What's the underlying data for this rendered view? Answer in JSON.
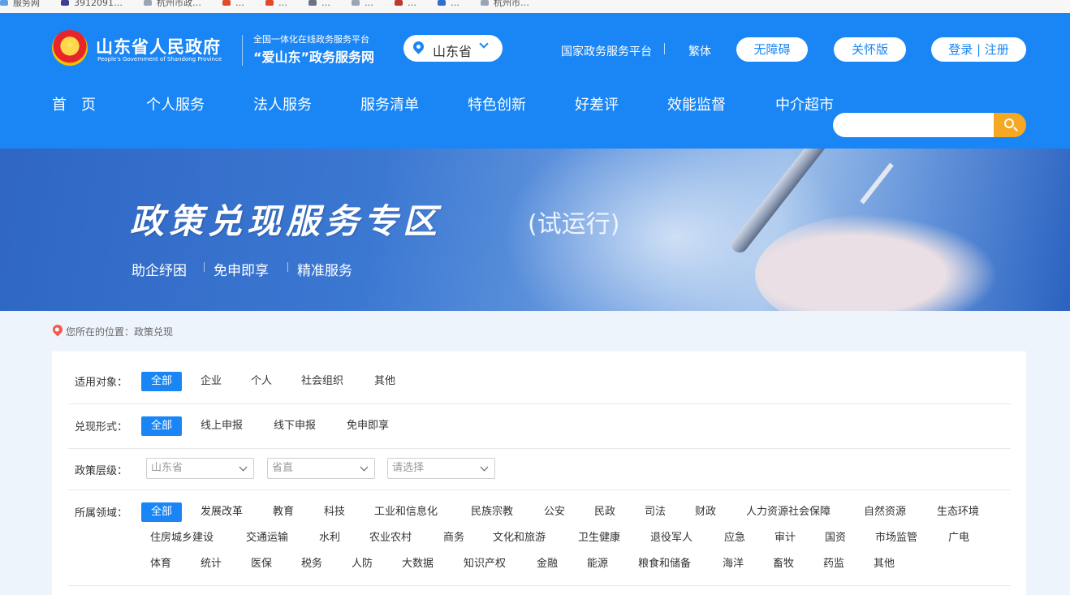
{
  "bookmarks": [
    {
      "label": "服务网",
      "color": "#5aa0e6"
    },
    {
      "label": "3912091…",
      "color": "#3a3f8f"
    },
    {
      "label": "杭州市政…",
      "color": "#9aa4b4"
    },
    {
      "label": "…",
      "color": "#e24a2a"
    },
    {
      "label": "…",
      "color": "#e24a2a"
    },
    {
      "label": "…",
      "color": "#6b7280"
    },
    {
      "label": "…",
      "color": "#9aa4b4"
    },
    {
      "label": "…",
      "color": "#c0392b"
    },
    {
      "label": "…",
      "color": "#2f6fd1"
    },
    {
      "label": "杭州市…",
      "color": "#9aa4b4"
    }
  ],
  "header": {
    "site_name": "山东省人民政府",
    "site_name_en": "People's Government of Shandong Province",
    "platform_line1": "全国一体化在线政务服务平台",
    "platform_line2": "“爱山东”政务服务网",
    "region": "山东省",
    "links": {
      "national_platform": "国家政务服务平台",
      "traditional": "繁体",
      "accessibility": "无障碍",
      "elder_mode": "关怀版",
      "login_register": "登录 | 注册"
    },
    "nav": [
      "首　页",
      "个人服务",
      "法人服务",
      "服务清单",
      "特色创新",
      "好差评",
      "效能监督",
      "中介超市"
    ],
    "search_placeholder": ""
  },
  "banner": {
    "title": "政策兑现服务专区",
    "subtitle": "(试运行)",
    "taglines": [
      "助企纾困",
      "免申即享",
      "精准服务"
    ]
  },
  "breadcrumb": "您所在的位置：政策兑现",
  "filters": {
    "target": {
      "label": "适用对象：",
      "options": [
        "全部",
        "企业",
        "个人",
        "社会组织",
        "其他"
      ]
    },
    "form": {
      "label": "兑现形式：",
      "options": [
        "全部",
        "线上申报",
        "线下申报",
        "免申即享"
      ]
    },
    "level": {
      "label": "政策层级：",
      "selects": [
        "山东省",
        "省直",
        "请选择"
      ]
    },
    "field": {
      "label": "所属领域：",
      "row1": [
        "全部",
        "发展改革",
        "教育",
        "科技",
        "工业和信息化",
        "民族宗教",
        "公安",
        "民政",
        "司法",
        "财政",
        "人力资源社会保障",
        "自然资源",
        "生态环境"
      ],
      "row2": [
        "住房城乡建设",
        "交通运输",
        "水利",
        "农业农村",
        "商务",
        "文化和旅游",
        "卫生健康",
        "退役军人",
        "应急",
        "审计",
        "国资",
        "市场监管",
        "广电"
      ],
      "row3": [
        "体育",
        "统计",
        "医保",
        "税务",
        "人防",
        "大数据",
        "知识产权",
        "金融",
        "能源",
        "粮食和储备",
        "海洋",
        "畜牧",
        "药监",
        "其他"
      ]
    }
  },
  "colors": {
    "primary": "#1a86f5",
    "search_button": "#f7a823",
    "page_bg": "#eef4fc"
  }
}
